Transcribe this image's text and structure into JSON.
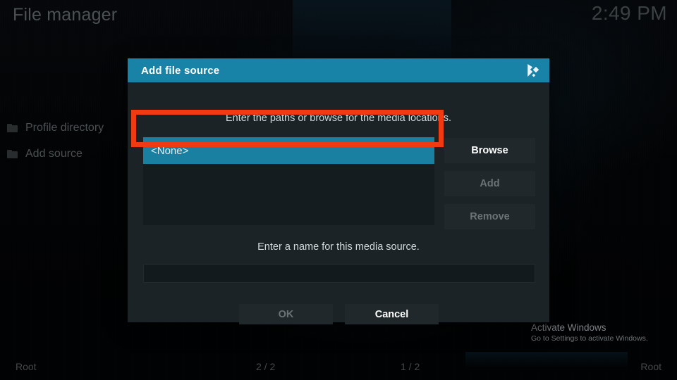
{
  "window": {
    "title": "File manager",
    "clock": "2:49 PM"
  },
  "background_list": {
    "items": [
      {
        "label": "Profile directory",
        "icon": "folder-icon"
      },
      {
        "label": "Add source",
        "icon": "folder-icon"
      }
    ]
  },
  "status_bar": {
    "left_path": "Root",
    "left_count": "2 / 2",
    "right_count": "1 / 2",
    "right_path": "Root"
  },
  "watermark": {
    "title": "Activate Windows",
    "subtitle": "Go to Settings to activate Windows."
  },
  "dialog": {
    "title": "Add file source",
    "logo_icon": "kodi-logo-icon",
    "caption_paths": "Enter the paths or browse for the media locations.",
    "caption_name": "Enter a name for this media source.",
    "path_list": {
      "selected_value": "<None>",
      "items": [
        "<None>"
      ]
    },
    "side_buttons": [
      {
        "label": "Browse",
        "state": "enabled"
      },
      {
        "label": "Add",
        "state": "disabled"
      },
      {
        "label": "Remove",
        "state": "disabled"
      }
    ],
    "name_input": {
      "value": "",
      "placeholder": ""
    },
    "footer_buttons": [
      {
        "label": "OK",
        "state": "disabled"
      },
      {
        "label": "Cancel",
        "state": "enabled"
      }
    ]
  },
  "colors": {
    "accent_teal": "#1883a6",
    "selection_teal": "#1a80a1",
    "annotation_red": "#f03a12",
    "dialog_body": "#1b2327",
    "button_bg": "#20282c",
    "disabled_text": "#6b7376"
  }
}
